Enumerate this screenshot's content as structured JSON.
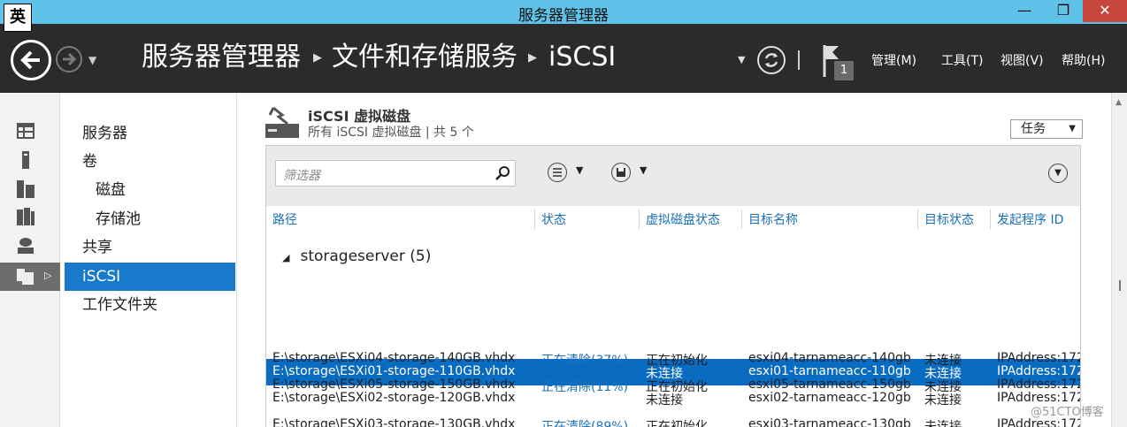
{
  "ime_indicator": "英",
  "window": {
    "title": "服务器管理器",
    "minimize": "—",
    "maximize": "❐",
    "close": "✕"
  },
  "header": {
    "breadcrumb": [
      "服务器管理器",
      "文件和存储服务",
      "iSCSI"
    ],
    "notification_count": "1",
    "menus": [
      "管理(M)",
      "工具(T)",
      "视图(V)",
      "帮助(H)"
    ]
  },
  "sidebar_icons": [
    "dashboard-icon",
    "local-server-icon",
    "all-servers-icon",
    "file-services-icon",
    "storage-icon",
    "file-storage-icon"
  ],
  "nav": {
    "items": [
      "服务器",
      "卷",
      "磁盘",
      "存储池",
      "共享",
      "iSCSI",
      "工作文件夹"
    ],
    "selected": "iSCSI"
  },
  "tile": {
    "title": "iSCSI 虚拟磁盘",
    "subtitle": "所有 iSCSI 虚拟磁盘 | 共 5 个",
    "task_label": "任务"
  },
  "filter": {
    "placeholder": "筛选器"
  },
  "columns": [
    "路径",
    "状态",
    "虚拟磁盘状态",
    "目标名称",
    "目标状态",
    "发起程序 ID"
  ],
  "group": {
    "label": "storageserver (5)"
  },
  "rows": [
    {
      "path": "E:\\storage\\ESXi01-storage-110GB.vhdx",
      "status": "",
      "disk_status": "未连接",
      "target": "esxi01-tarnameacc-110gb",
      "target_status": "未连接",
      "initiator": "IPAddress:172",
      "selected": true
    },
    {
      "path": "E:\\storage\\ESXi02-storage-120GB.vhdx",
      "status": "",
      "disk_status": "未连接",
      "target": "esxi02-tarnameacc-120gb",
      "target_status": "未连接",
      "initiator": "IPAddress:172",
      "selected": false
    },
    {
      "path": "E:\\storage\\ESXi03-storage-130GB.vhdx",
      "status": "正在清除(89%)",
      "disk_status": "正在初始化",
      "target": "esxi03-tarnameacc-130gb",
      "target_status": "未连接",
      "initiator": "IPAddress:172",
      "selected": false
    },
    {
      "path": "E:\\storage\\ESXi04-storage-140GB.vhdx",
      "status": "正在清除(37%)",
      "disk_status": "正在初始化",
      "target": "esxi04-tarnameacc-140gb",
      "target_status": "未连接",
      "initiator": "IPAddress:172",
      "selected": false
    },
    {
      "path": "E:\\storage\\ESXi05-storage-150GB.vhdx",
      "status": "正在清除(11%)",
      "disk_status": "正在初始化",
      "target": "esxi05-tarnameacc-150gb",
      "target_status": "未连接",
      "initiator": "IPAddress:172",
      "selected": false
    }
  ],
  "watermark": "@51CTO博客",
  "colors": {
    "titlebar": "#5fc2e8",
    "header": "#2b2b2b",
    "selection": "#0a6cc1",
    "link": "#1a70b8",
    "close": "#c7463c"
  }
}
